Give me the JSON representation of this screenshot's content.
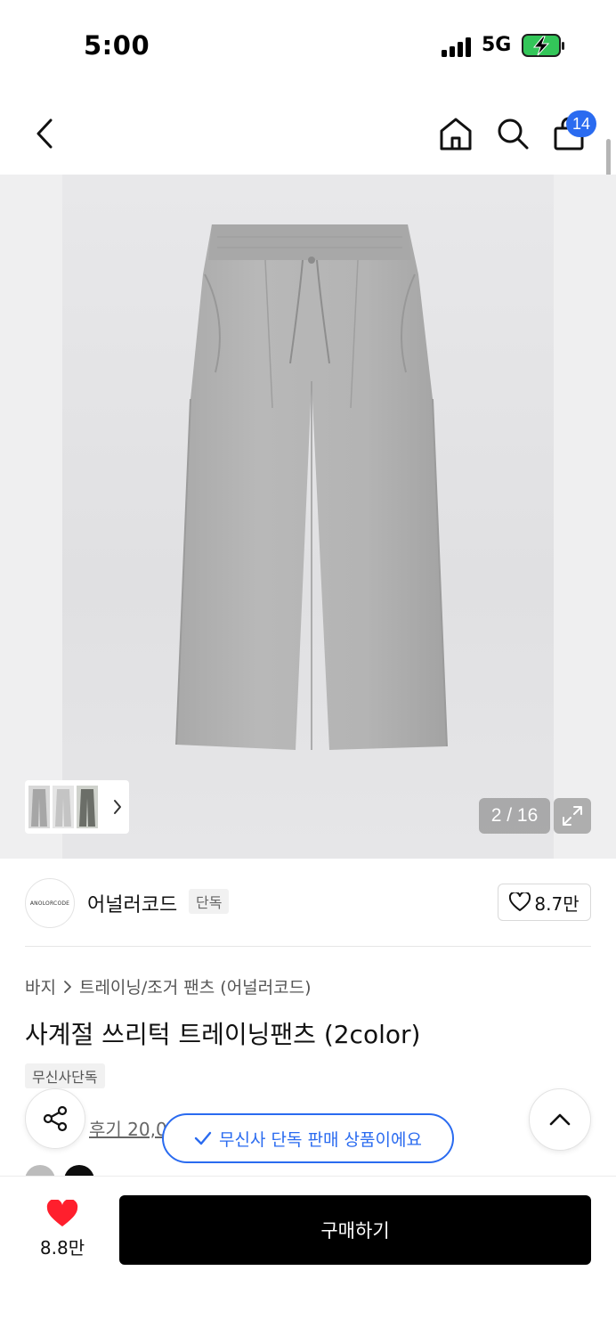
{
  "status_bar": {
    "time": "5:00",
    "network": "5G"
  },
  "nav": {
    "cart_count": "14"
  },
  "gallery": {
    "page_counter": "2 / 16"
  },
  "brand": {
    "logo_text": "ANOLORCODE",
    "name": "어널러코드",
    "tag": "단독",
    "likes": "8.7만"
  },
  "product": {
    "breadcrumb": [
      "바지",
      "트레이닝/조거 팬츠 (어널러코드)"
    ],
    "title": "사계절 쓰리턱 트레이닝팬츠 (2color)",
    "exclusive_badge": "무신사단독",
    "review_text": "후기 20,0",
    "swatches": [
      "#bcbcbc",
      "#0d0d0d"
    ]
  },
  "toast": {
    "message": "무신사 단독 판매 상품이에요"
  },
  "bottom_bar": {
    "wish_count": "8.8만",
    "buy_label": "구매하기"
  },
  "colors": {
    "accent_blue": "#2a6bf0",
    "heart_red": "#ff1f2d",
    "buy_bg": "#000000"
  },
  "icons": [
    "back-icon",
    "home-icon",
    "search-icon",
    "cart-icon",
    "expand-icon",
    "share-icon",
    "chevron-up-icon",
    "heart-icon",
    "check-icon"
  ]
}
